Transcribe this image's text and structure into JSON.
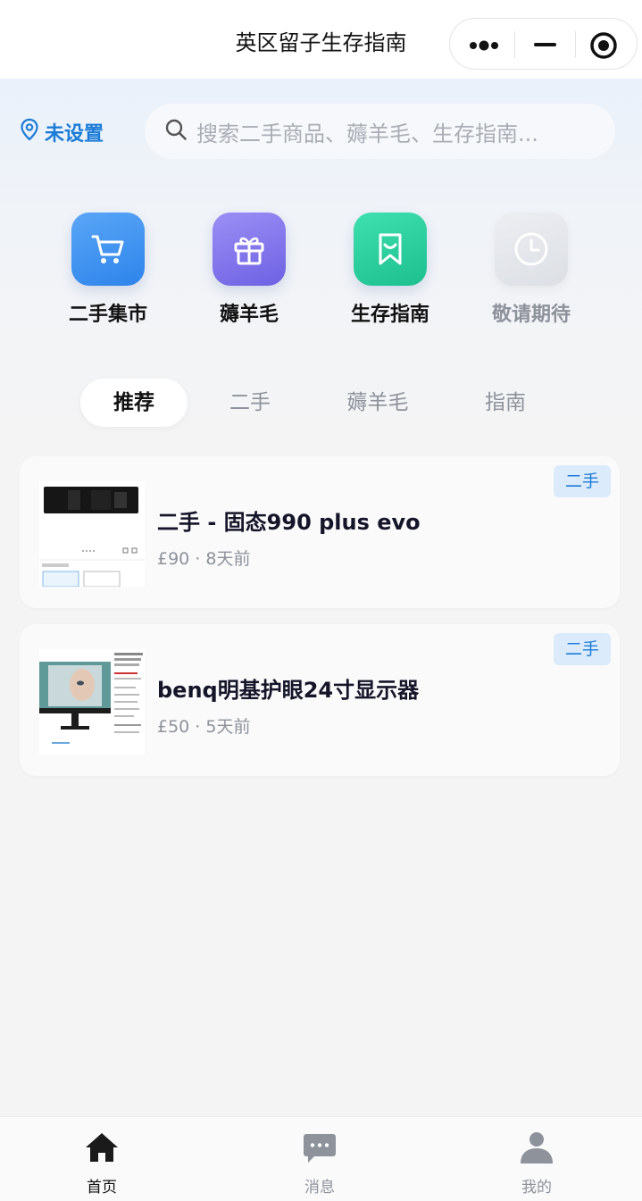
{
  "titlebar": {
    "title": "英区留子生存指南",
    "more_icon": "more-dots-icon",
    "minimize_icon": "minimize-icon",
    "close_icon": "target-close-icon"
  },
  "header": {
    "location_label": "未设置",
    "location_icon": "location-pin-icon",
    "search_placeholder": "搜索二手商品、薅羊毛、生存指南...",
    "search_icon": "search-icon"
  },
  "quick_actions": [
    {
      "label": "二手集市",
      "icon": "shopping-cart-icon",
      "color": "#3d8ff0"
    },
    {
      "label": "薅羊毛",
      "icon": "gift-icon",
      "color": "#7f72ea"
    },
    {
      "label": "生存指南",
      "icon": "bookmark-icon",
      "color": "#2bcf9f"
    },
    {
      "label": "敬请期待",
      "icon": "clock-icon",
      "color": "#e3e5ea",
      "disabled": true
    }
  ],
  "tabs": [
    {
      "label": "推荐",
      "active": true
    },
    {
      "label": "二手"
    },
    {
      "label": "薅羊毛"
    },
    {
      "label": "指南"
    }
  ],
  "listings": [
    {
      "title": "二手 - 固态990 plus evo",
      "meta": "£90 · 8天前",
      "badge": "二手",
      "thumb": "ssd-product-thumbnail"
    },
    {
      "title": "benq明基护眼24寸显示器",
      "meta": "£50 · 5天前",
      "badge": "二手",
      "thumb": "monitor-product-thumbnail"
    }
  ],
  "bottom_nav": [
    {
      "label": "首页",
      "icon": "home-icon",
      "active": true
    },
    {
      "label": "消息",
      "icon": "message-icon"
    },
    {
      "label": "我的",
      "icon": "user-icon"
    }
  ],
  "colors": {
    "accent": "#1a7cd8",
    "badge_bg": "#dcebfb",
    "muted_text": "#8d929b"
  }
}
